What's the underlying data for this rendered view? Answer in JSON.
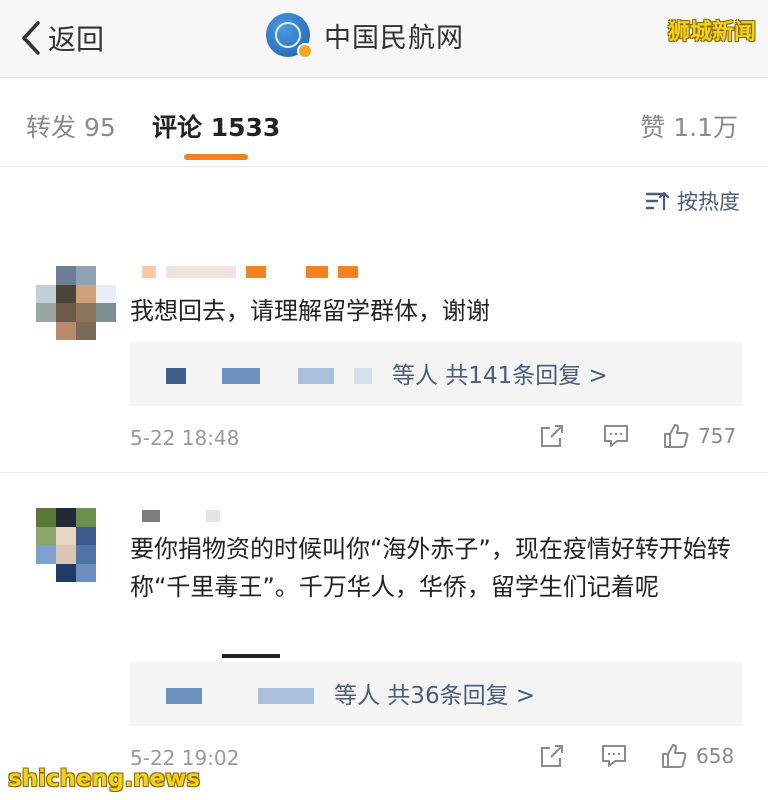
{
  "header": {
    "back_label": "返回",
    "account_name": "中国民航网",
    "watermark": "狮城新闻"
  },
  "tabs": [
    {
      "label": "转发 95"
    },
    {
      "label": "评论 1533"
    },
    {
      "label": "赞 1.1万"
    }
  ],
  "sort_label": "按热度",
  "comments": [
    {
      "text": "我想回去，请理解留学群体，谢谢",
      "replies_label": "等人 共141条回复 >",
      "date": "5-22 18:48",
      "likes": "757"
    },
    {
      "text": "要你捐物资的时候叫你“海外赤子”，现在疫情好转开始转称“千里毒王”。千万华人，华侨，留学生们记着呢",
      "replies_label": "等人 共36条回复 >",
      "date": "5-22 19:02",
      "likes": "658"
    }
  ],
  "footer_watermark": "shicheng.news",
  "colors": {
    "accent_orange": "#f5821f",
    "link_blue": "#4b5c7d",
    "watermark_yellow": "#f2d21c"
  },
  "icons": [
    "chevron-left-icon",
    "verified-badge-icon",
    "sort-icon",
    "share-icon",
    "comment-icon",
    "thumbs-up-icon"
  ]
}
